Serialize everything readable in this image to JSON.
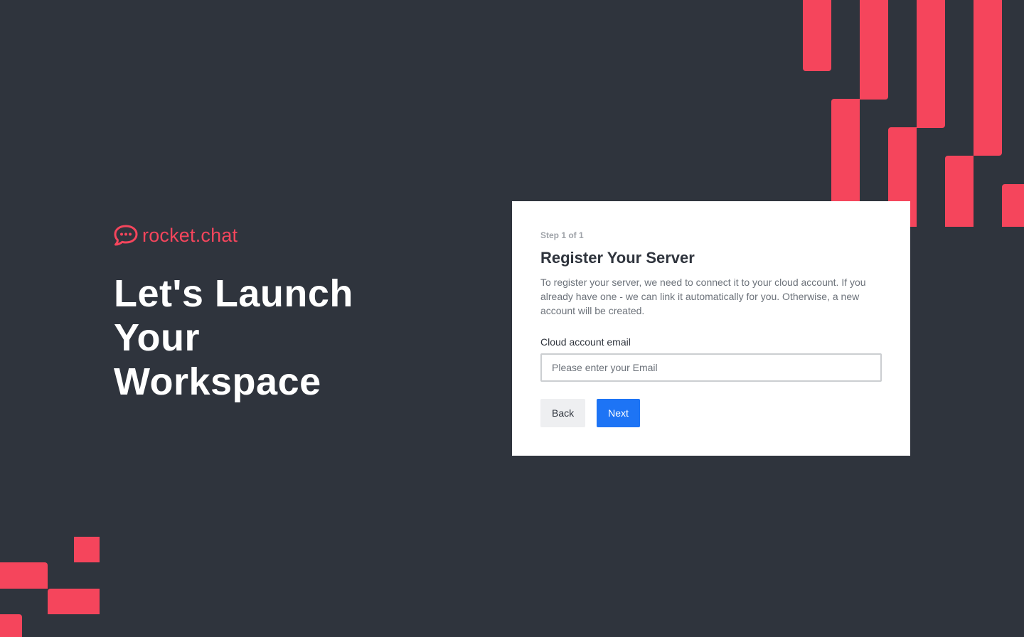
{
  "brand": {
    "name": "rocket.chat",
    "logo_icon": "rocket-chat-logo-icon",
    "color": "#f5455c"
  },
  "hero": {
    "title": "Let's Launch Your Workspace"
  },
  "card": {
    "step": "Step 1 of 1",
    "title": "Register Your Server",
    "description": "To register your server, we need to connect it to your cloud account. If you already have one - we can link it automatically for you. Otherwise, a new account will be created.",
    "email_label": "Cloud account email",
    "email_value": "",
    "email_placeholder": "Please enter your Email",
    "back_label": "Back",
    "next_label": "Next"
  },
  "colors": {
    "background": "#2f343d",
    "accent": "#f5455c",
    "primary_button": "#1d74f5",
    "secondary_button": "#eeeff1"
  }
}
